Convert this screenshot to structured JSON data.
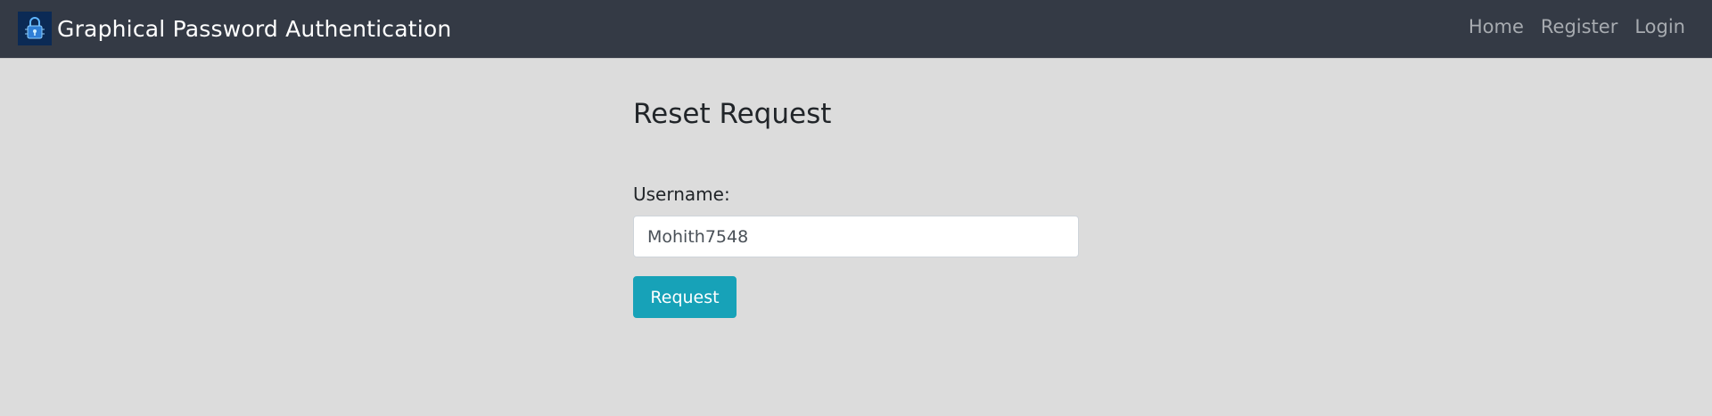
{
  "navbar": {
    "title": "Graphical Password Authentication",
    "logo_icon": "padlock-icon",
    "background_color": "#343a45",
    "links": [
      {
        "label": "Home"
      },
      {
        "label": "Register"
      },
      {
        "label": "Login"
      }
    ]
  },
  "main": {
    "title": "Reset Request",
    "username_label": "Username:",
    "username_value": "Mohith7548",
    "submit_label": "Request",
    "accent_color": "#17a2b8"
  }
}
